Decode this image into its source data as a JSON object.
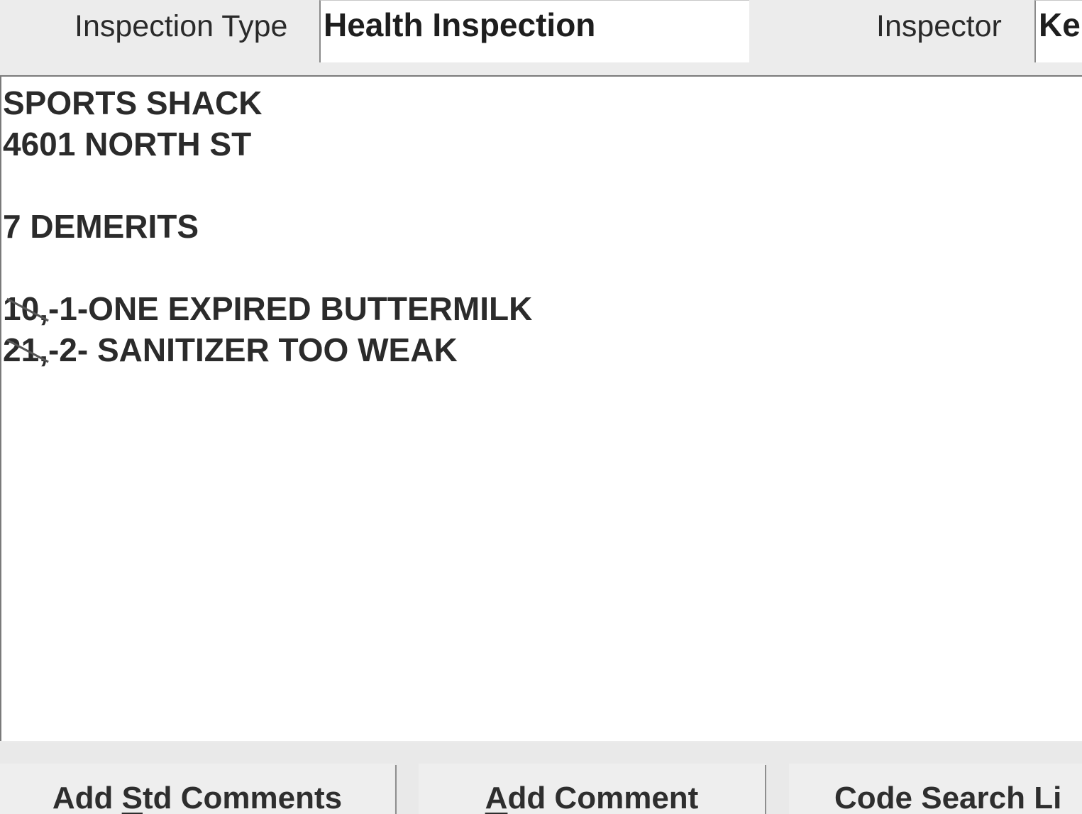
{
  "header": {
    "inspection_type_label": "Inspection Type",
    "inspection_type_value": "Health Inspection",
    "inspector_label": "Inspector",
    "inspector_value": "Ke"
  },
  "comments": {
    "lines": [
      "SPORTS SHACK",
      "4601 NORTH ST",
      "",
      "7 DEMERITS",
      ""
    ],
    "items": [
      {
        "num": "10,",
        "text": "-1-ONE EXPIRED BUTTERMILK"
      },
      {
        "num": "21,",
        "text": "-2- SANITIZER TOO WEAK"
      }
    ]
  },
  "buttons": {
    "add_std_comments": {
      "pre": "Add ",
      "accel": "S",
      "post": "td Comments"
    },
    "add_comment": {
      "pre": "",
      "accel": "A",
      "post": "dd Comment"
    },
    "code_search": {
      "pre": "Code Search Li",
      "accel": "",
      "post": ""
    }
  }
}
